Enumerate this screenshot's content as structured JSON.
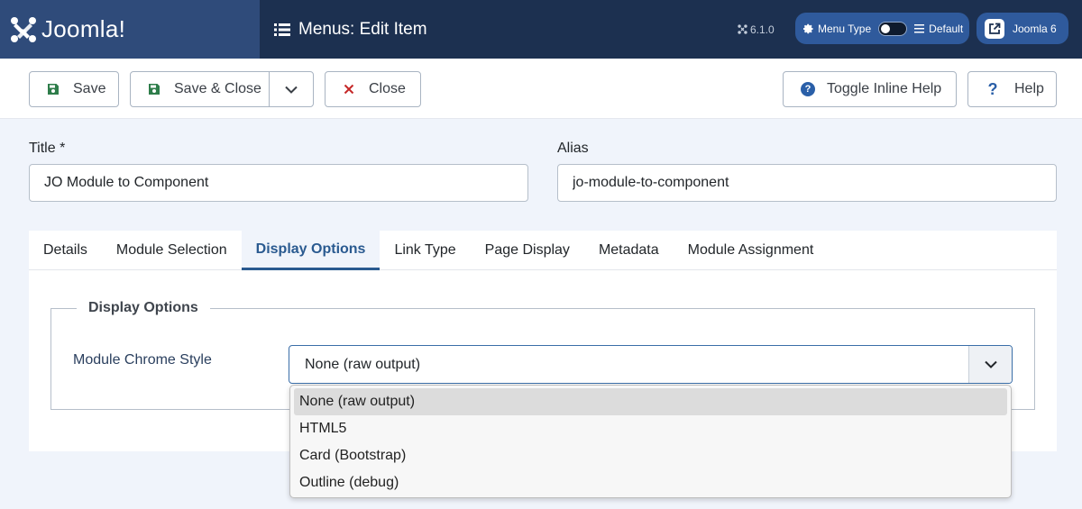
{
  "header": {
    "logo_text": "Joomla!",
    "page_title": "Menus: Edit Item",
    "version": "6.1.0",
    "menu_type_label": "Menu Type",
    "menu_type_value": "Default",
    "site_label": "Joomla 6"
  },
  "toolbar": {
    "save": "Save",
    "save_close": "Save & Close",
    "close": "Close",
    "toggle_help": "Toggle Inline Help",
    "help": "Help"
  },
  "form": {
    "title_label": "Title *",
    "title_value": "JO Module to Component",
    "alias_label": "Alias",
    "alias_value": "jo-module-to-component"
  },
  "tabs": [
    {
      "label": "Details",
      "active": false
    },
    {
      "label": "Module Selection",
      "active": false
    },
    {
      "label": "Display Options",
      "active": true
    },
    {
      "label": "Link Type",
      "active": false
    },
    {
      "label": "Page Display",
      "active": false
    },
    {
      "label": "Metadata",
      "active": false
    },
    {
      "label": "Module Assignment",
      "active": false
    }
  ],
  "display_options": {
    "legend": "Display Options",
    "chrome_label": "Module Chrome Style",
    "chrome_value": "None (raw output)",
    "options": [
      "None (raw output)",
      "HTML5",
      "Card (Bootstrap)",
      "Outline (debug)"
    ]
  },
  "colors": {
    "header_bg": "#1c3050",
    "logo_bg": "#2f4b7a",
    "accent": "#2a5a90",
    "save_icon": "#2e7d4a",
    "close_icon": "#c52828"
  },
  "icons": {
    "save": "save-icon",
    "close": "close-icon",
    "help": "help-icon",
    "menu": "list-icon",
    "external": "external-link-icon"
  }
}
